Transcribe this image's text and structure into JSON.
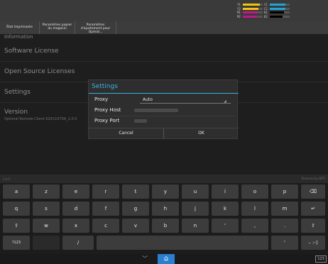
{
  "toner": {
    "left": [
      {
        "label": "Y1",
        "color": "#f1c40f",
        "level": 0.85
      },
      {
        "label": "Y2",
        "color": "#f1c40f",
        "level": 0.8
      },
      {
        "label": "M1",
        "color": "#c0188a",
        "level": 0.75
      },
      {
        "label": "M2",
        "color": "#c0188a",
        "level": 0.7
      }
    ],
    "right": [
      {
        "label": "C1",
        "color": "#21a5d8",
        "level": 0.8
      },
      {
        "label": "C2",
        "color": "#21a5d8",
        "level": 0.78
      },
      {
        "label": "K1",
        "color": "#000000",
        "level": 0.72
      },
      {
        "label": "K2",
        "color": "#000000",
        "level": 0.65
      }
    ]
  },
  "tabs": [
    {
      "label": "État imprimante"
    },
    {
      "label": "Paramètres papier du magasin"
    },
    {
      "label": "Paramètres d'ajustement pour Opérat..."
    }
  ],
  "info": {
    "header": "Information",
    "items": [
      {
        "label": "Software License"
      },
      {
        "label": "Open Source Licenses"
      },
      {
        "label": "Settings"
      },
      {
        "label": "Version"
      }
    ],
    "version_value": "Optimal Remote Client 02411670A_1.0.5"
  },
  "dialog": {
    "title": "Settings",
    "proxy_label": "Proxy",
    "proxy_value": "Auto",
    "host_label": "Proxy Host",
    "port_label": "Proxy Port",
    "cancel_label": "Cancel",
    "ok_label": "OK"
  },
  "footer": {
    "left": "1.0.5",
    "right": "Powered by BPTI"
  },
  "keyboard": {
    "row1": [
      "a",
      "z",
      "e",
      "r",
      "t",
      "y",
      "u",
      "i",
      "o",
      "p",
      "⌫"
    ],
    "row2": [
      "q",
      "s",
      "d",
      "f",
      "g",
      "h",
      "j",
      "k",
      "l",
      "m",
      "↵"
    ],
    "row3": [
      "⇧",
      "w",
      "x",
      "c",
      "v",
      "b",
      "n",
      "'",
      ",",
      ".",
      "⇧"
    ],
    "row4": [
      "?123",
      "",
      "/",
      "",
      "'",
      "–",
      ":-)"
    ]
  },
  "navbar": {
    "down_icon": "chevron-down-icon",
    "home_icon": "home-icon",
    "ime_label": "123"
  }
}
